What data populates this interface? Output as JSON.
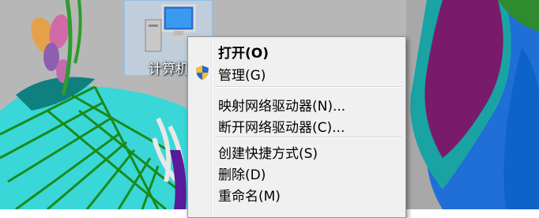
{
  "desktop": {
    "icon": {
      "name": "computer-icon",
      "label": "计算机"
    }
  },
  "context_menu": {
    "items": [
      {
        "label": "打开(O)",
        "bold": true
      },
      {
        "label": "管理(G)",
        "icon": "uac-shield-icon"
      },
      {
        "label": "映射网络驱动器(N)..."
      },
      {
        "label": "断开网络驱动器(C)..."
      },
      {
        "label": "创建快捷方式(S)"
      },
      {
        "label": "删除(D)"
      },
      {
        "label": "重命名(M)"
      }
    ]
  },
  "colors": {
    "menu_bg": "#f0f0f0",
    "menu_border": "#979797",
    "wallpaper_bg": "#b7b7b7"
  }
}
